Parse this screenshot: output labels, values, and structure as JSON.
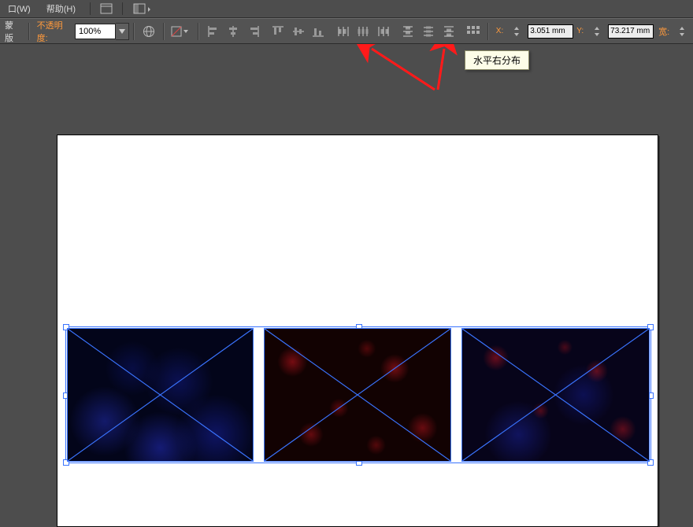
{
  "menu": {
    "window": "口(W)",
    "help": "帮助(H)"
  },
  "options": {
    "mask_label": "蒙版",
    "opacity_label": "不透明度:",
    "opacity_value": "100%",
    "x_label": "X:",
    "x_value": "3.051 mm",
    "y_label": "Y:",
    "y_value": "73.217 mm",
    "w_label": "宽:"
  },
  "tooltip": {
    "text": "水平右分布"
  },
  "icons": {
    "globe": "globe-icon",
    "swatch": "swatch-dropdown-icon"
  }
}
